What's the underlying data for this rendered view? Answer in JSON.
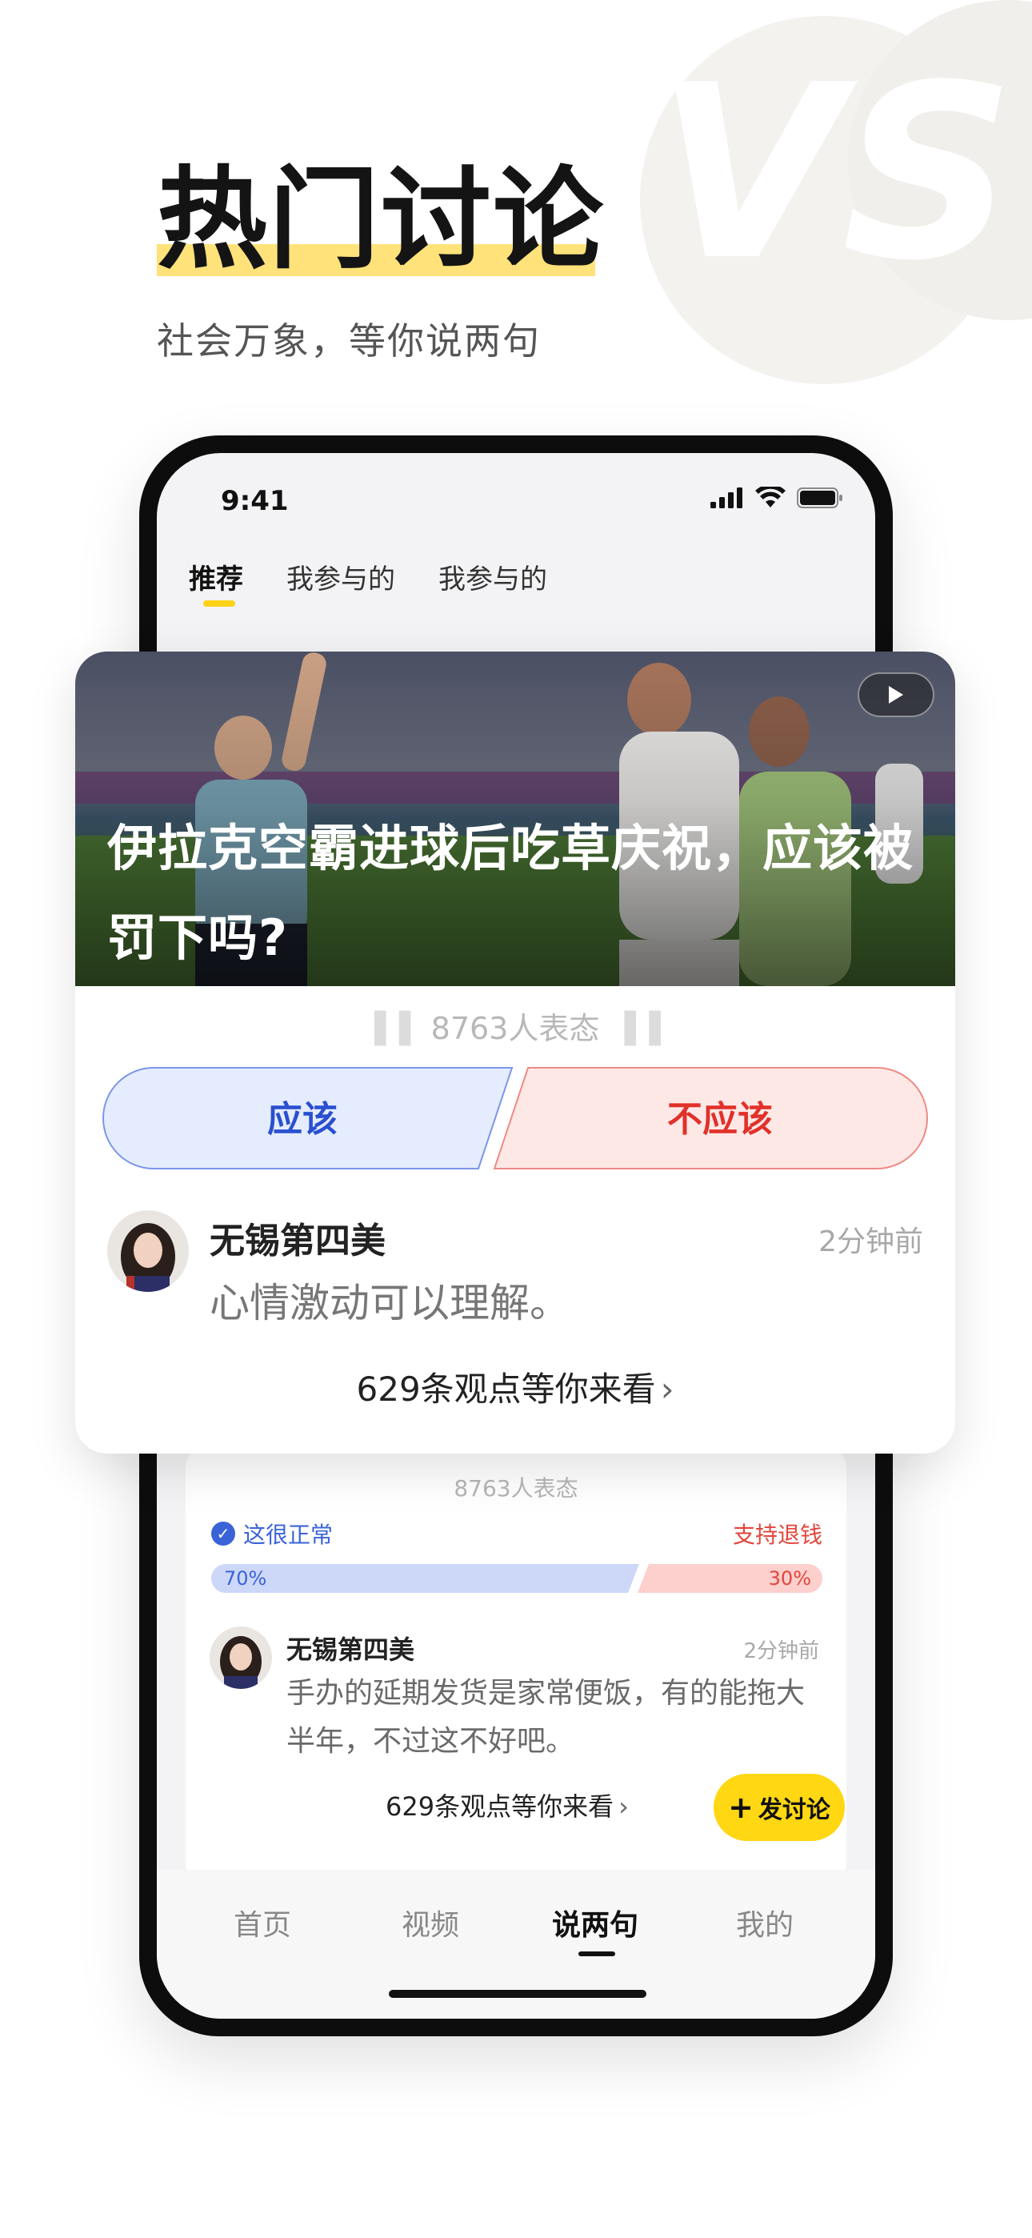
{
  "hero": {
    "title": "热门讨论",
    "subtitle": "社会万象，等你说两句"
  },
  "status_bar": {
    "time": "9:41"
  },
  "top_tabs": [
    {
      "label": "推荐",
      "active": true
    },
    {
      "label": "我参与的",
      "active": false
    },
    {
      "label": "我参与的",
      "active": false
    }
  ],
  "featured": {
    "title": "伊拉克空霸进球后吃草庆祝，应该被罚下吗?",
    "participants": "8763人表态",
    "option_a": "应该",
    "option_b": "不应该",
    "comment": {
      "user": "无锡第四美",
      "time": "2分钟前",
      "text": "心情激动可以理解。"
    },
    "more": "629条观点等你来看"
  },
  "second": {
    "participants": "8763人表态",
    "side_a": "这很正常",
    "side_b": "支持退钱",
    "pct_a_label": "70%",
    "pct_b_label": "30%",
    "pct_a": 0.7,
    "comment": {
      "user": "无锡第四美",
      "time": "2分钟前",
      "text": "手办的延期发货是家常便饭，有的能拖大半年，不过这不好吧。"
    },
    "more": "629条观点等你来看",
    "post_button": "发讨论"
  },
  "bottom_nav": [
    {
      "label": "首页",
      "active": false
    },
    {
      "label": "视频",
      "active": false
    },
    {
      "label": "说两句",
      "active": true
    },
    {
      "label": "我的",
      "active": false
    }
  ],
  "colors": {
    "accent_yellow": "#ffd713",
    "side_a_blue": "#2a4fd0",
    "side_b_red": "#e2302a"
  }
}
